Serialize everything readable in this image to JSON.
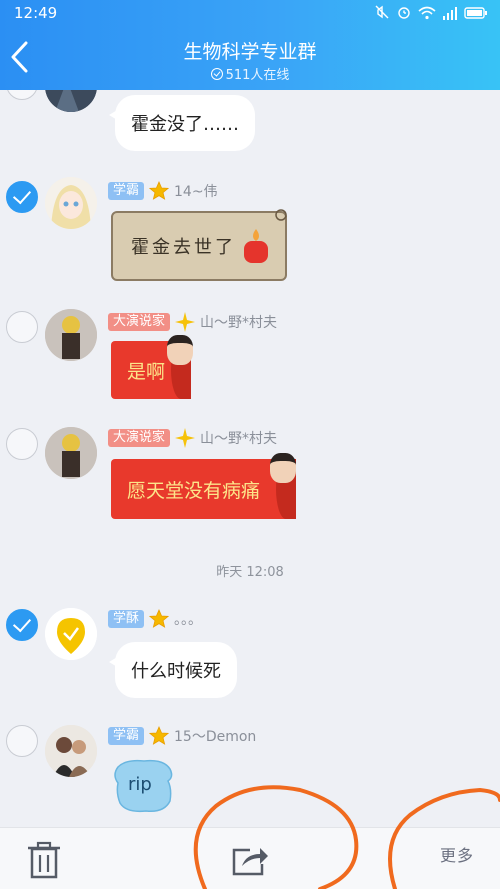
{
  "statusbar": {
    "time": "12:49"
  },
  "header": {
    "title": "生物科学专业群",
    "online": "511人在线"
  },
  "messages": [
    {
      "text": "霍金没了……"
    },
    {
      "badge": "学霸",
      "name": "14~伟",
      "card": "霍金去世了"
    },
    {
      "badge": "大演说家",
      "name": "山～野*村夫",
      "text": "是啊"
    },
    {
      "badge": "大演说家",
      "name": "山～野*村夫",
      "text": "愿天堂没有病痛"
    },
    {
      "badge": "学酥",
      "name": "。。。",
      "text": "什么时候死"
    },
    {
      "badge": "学霸",
      "name": "15～Demon",
      "sticker": "rip"
    }
  ],
  "timestamp": "昨天 12:08",
  "toolbar": {
    "more": "更多"
  },
  "colors": {
    "header_start": "#2b8ff3",
    "header_end": "#38c3f6",
    "accent": "#2c9af2",
    "doodle": "#f06a1e"
  }
}
